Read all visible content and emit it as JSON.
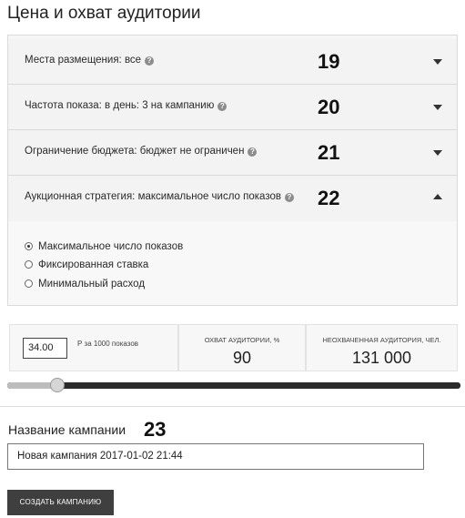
{
  "heading": "Цена и охват аудитории",
  "settings": [
    {
      "label": "Места размещения: все",
      "number": "19",
      "expanded": false
    },
    {
      "label": "Частота показа: в день: 3 на кампанию",
      "number": "20",
      "expanded": false
    },
    {
      "label": "Ограничение бюджета: бюджет не ограничен",
      "number": "21",
      "expanded": false
    },
    {
      "label": "Аукционная стратегия: максимальное число показов",
      "number": "22",
      "expanded": true
    }
  ],
  "strategy_options": [
    {
      "label": "Максимальное число показов",
      "selected": true
    },
    {
      "label": "Фиксированная ставка",
      "selected": false
    },
    {
      "label": "Минимальный расход",
      "selected": false
    }
  ],
  "bid": {
    "value": "34.00",
    "unit": "Р за 1000 показов"
  },
  "coverage": {
    "caption": "ОХВАТ АУДИТОРИИ, %",
    "value": "90"
  },
  "uncovered": {
    "caption": "НЕОХВАЧЕННАЯ АУДИТОРИЯ, ЧЕЛ.",
    "value": "131 000"
  },
  "slider": {
    "level": 0.11
  },
  "campaign": {
    "label": "Название кампании",
    "number": "23",
    "name": "Новая кампания 2017-01-02 21:44"
  },
  "create_button": "СОЗДАТЬ КАМПАНИЮ"
}
